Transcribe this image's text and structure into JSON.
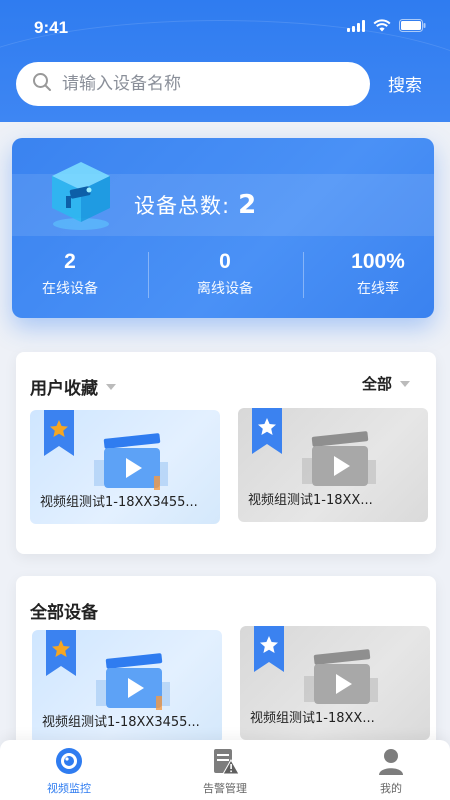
{
  "status_bar": {
    "time": "9:41"
  },
  "search": {
    "placeholder": "请输入设备名称",
    "button_label": "搜索"
  },
  "stats": {
    "total_label": "设备总数:",
    "total_value": "2",
    "columns": [
      {
        "value": "2",
        "label": "在线设备"
      },
      {
        "value": "0",
        "label": "离线设备"
      },
      {
        "value": "100%",
        "label": "在线率"
      }
    ]
  },
  "favorites": {
    "title": "用户收藏",
    "filter_label": "全部",
    "items": [
      {
        "name": "视频组测试1-18XX3455...",
        "status": "online"
      },
      {
        "name": "视频组测试1-18XX...",
        "status": "offline"
      }
    ]
  },
  "all_devices": {
    "title": "全部设备",
    "items": [
      {
        "name": "视频组测试1-18XX3455...",
        "status": "online"
      },
      {
        "name": "视频组测试1-18XX...",
        "status": "offline"
      }
    ]
  },
  "bottom_nav": [
    {
      "label": "视频监控",
      "icon": "video-monitor-icon",
      "active": true
    },
    {
      "label": "告警管理",
      "icon": "alarm-manage-icon",
      "active": false
    },
    {
      "label": "我的",
      "icon": "user-profile-icon",
      "active": false
    }
  ],
  "colors": {
    "primary": "#2f7cf0",
    "star": "#f5a623",
    "ribbon": "#3b82f0"
  }
}
